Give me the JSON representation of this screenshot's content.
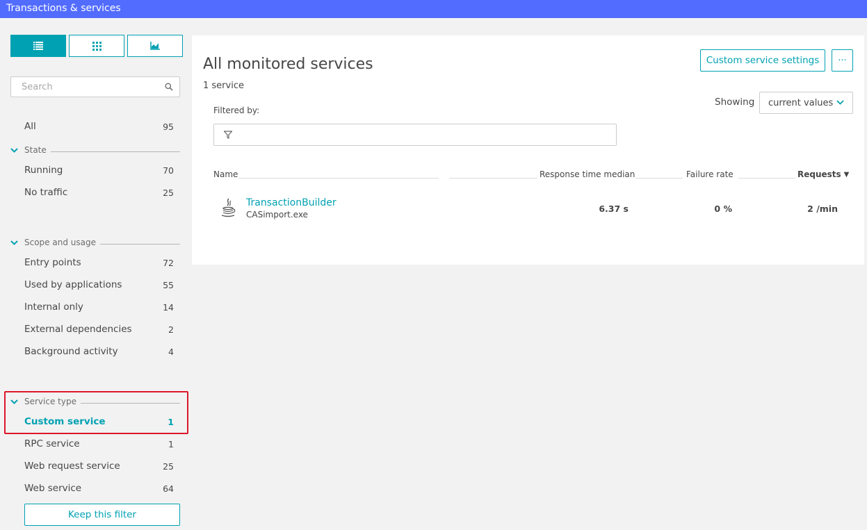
{
  "header": {
    "title": "Transactions & services"
  },
  "view_toggle": [
    {
      "icon": "list-icon",
      "active": true
    },
    {
      "icon": "grid-icon",
      "active": false
    },
    {
      "icon": "chart-icon",
      "active": false
    }
  ],
  "search": {
    "placeholder": "Search",
    "icon": "search-icon"
  },
  "filters": {
    "all": {
      "label": "All",
      "count": "95"
    },
    "state": {
      "title": "State",
      "items": [
        {
          "label": "Running",
          "count": "70"
        },
        {
          "label": "No traffic",
          "count": "25"
        }
      ]
    },
    "scope": {
      "title": "Scope and usage",
      "items": [
        {
          "label": "Entry points",
          "count": "72"
        },
        {
          "label": "Used by applications",
          "count": "55"
        },
        {
          "label": "Internal only",
          "count": "14"
        },
        {
          "label": "External dependencies",
          "count": "2"
        },
        {
          "label": "Background activity",
          "count": "4"
        }
      ]
    },
    "service_type": {
      "title": "Service type",
      "items": [
        {
          "label": "Custom service",
          "count": "1",
          "selected": true
        },
        {
          "label": "RPC service",
          "count": "1"
        },
        {
          "label": "Web request service",
          "count": "25"
        },
        {
          "label": "Web service",
          "count": "64"
        }
      ]
    },
    "keep_button": "Keep this filter"
  },
  "main": {
    "title": "All monitored services",
    "count": "1 service",
    "custom_settings_button": "Custom service settings",
    "more_button": "···",
    "showing_label": "Showing",
    "showing_value": "current values",
    "filtered_by_label": "Filtered by:",
    "table": {
      "headers": {
        "name": "Name",
        "response": "Response time median",
        "failure": "Failure rate",
        "requests": "Requests",
        "sort_indicator": "▼"
      },
      "rows": [
        {
          "name": "TransactionBuilder",
          "sub": "CASimport.exe",
          "icon": "java-icon",
          "response": "6.37 s",
          "failure": "0 %",
          "requests": "2 /min"
        }
      ]
    }
  },
  "colors": {
    "header_bg": "#526cff",
    "accent": "#00a1b2",
    "highlight": "#dc172a"
  }
}
